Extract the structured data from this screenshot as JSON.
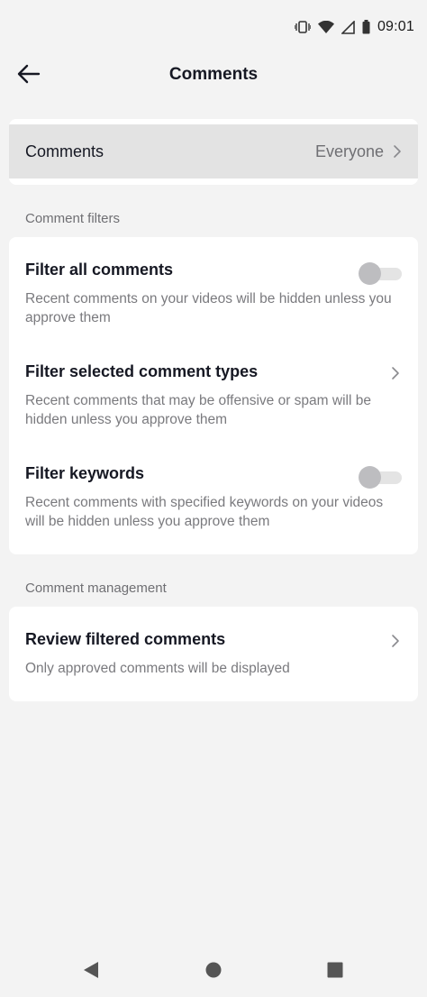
{
  "status_bar": {
    "time": "09:01",
    "icons": [
      "vibrate-icon",
      "wifi-icon",
      "cell-signal-icon",
      "battery-icon"
    ]
  },
  "header": {
    "title": "Comments",
    "back_icon": "arrow-left-icon"
  },
  "comments_setting": {
    "label": "Comments",
    "value": "Everyone"
  },
  "filters_section": {
    "title": "Comment filters",
    "items": [
      {
        "title": "Filter all comments",
        "description": "Recent comments on your videos will be hidden unless you approve them",
        "control": "toggle",
        "enabled": false
      },
      {
        "title": "Filter selected comment types",
        "description": "Recent comments that may be offensive or spam will be hidden unless you approve them",
        "control": "chevron"
      },
      {
        "title": "Filter keywords",
        "description": "Recent comments with specified keywords on your videos will be hidden unless you approve them",
        "control": "toggle",
        "enabled": false
      }
    ]
  },
  "management_section": {
    "title": "Comment management",
    "items": [
      {
        "title": "Review filtered comments",
        "description": "Only approved comments will be displayed",
        "control": "chevron"
      }
    ]
  },
  "nav_bar": {
    "icons": [
      "back-triangle-icon",
      "home-circle-icon",
      "recents-square-icon"
    ]
  },
  "colors": {
    "background": "#f3f3f3",
    "card": "#ffffff",
    "highlight_row": "#e3e3e3",
    "text_primary": "#161823",
    "text_secondary": "#7a7a7e"
  }
}
